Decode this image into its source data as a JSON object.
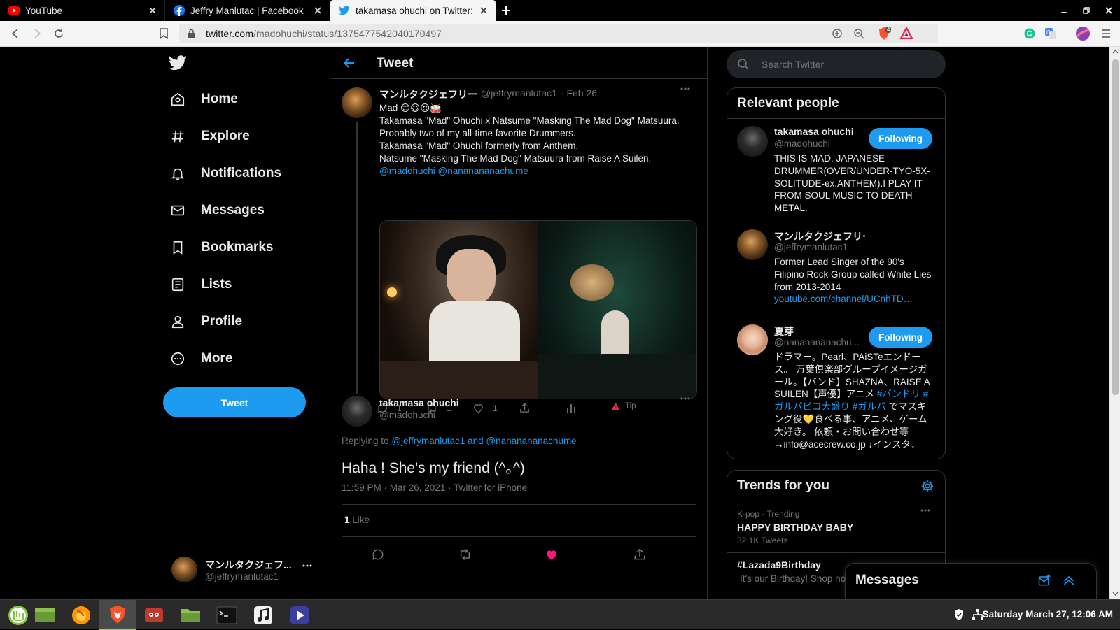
{
  "browser": {
    "tabs": [
      {
        "title": "YouTube",
        "icon": "youtube-icon"
      },
      {
        "title": "Jeffry Manlutac | Facebook",
        "icon": "facebook-icon"
      },
      {
        "title": "takamasa ohuchi on Twitter: \"@",
        "icon": "twitter-icon"
      }
    ],
    "url_host": "twitter.com",
    "url_path": "/madohuchi/status/1375477542040170497",
    "extension_badge": "4"
  },
  "sidebar": {
    "items": [
      {
        "label": "Home",
        "icon": "home-icon"
      },
      {
        "label": "Explore",
        "icon": "hashtag-icon"
      },
      {
        "label": "Notifications",
        "icon": "bell-icon"
      },
      {
        "label": "Messages",
        "icon": "envelope-icon"
      },
      {
        "label": "Bookmarks",
        "icon": "bookmark-icon"
      },
      {
        "label": "Lists",
        "icon": "list-icon"
      },
      {
        "label": "Profile",
        "icon": "person-icon"
      },
      {
        "label": "More",
        "icon": "more-circle-icon"
      }
    ],
    "tweet_button": "Tweet",
    "account": {
      "name": "マンルタクジェフ...",
      "handle": "@jeffrymanlutac1"
    }
  },
  "main": {
    "header_title": "Tweet",
    "parent_tweet": {
      "name": "マンルタクジェフリー",
      "handle": "@jeffrymanlutac1",
      "date": "· Feb 26",
      "line1": "Mad 😊😃😍🥁",
      "line2": "Takamasa \"Mad\" Ohuchi x Natsume \"Masking The Mad Dog\" Matsuura.",
      "line3": "Probably two of my all-time favorite Drummers.",
      "line4": "Takamasa \"Mad\" Ohuchi formerly from Anthem.",
      "line5": "Natsume \"Masking The Mad Dog\" Matsuura from Raise A Suilen.",
      "mention1": "@madohuchi",
      "mention2": "@nananananachume",
      "replies": "1",
      "retweets": "1",
      "likes": "1",
      "tip_label": "Tip"
    },
    "focused_tweet": {
      "name": "takamasa ohuchi",
      "handle": "@madohuchi",
      "replying_prefix": "Replying to",
      "replying_to1": "@jeffrymanlutac1",
      "replying_and": "and",
      "replying_to2": "@nananananachume",
      "text": "Haha ! She's my friend (^｡^)",
      "meta": "11:59 PM · Mar 26, 2021 · Twitter for iPhone",
      "like_count": "1",
      "like_label": "Like"
    }
  },
  "right": {
    "search_placeholder": "Search Twitter",
    "relevant_title": "Relevant people",
    "people": [
      {
        "name": "takamasa ohuchi",
        "handle": "@madohuchi",
        "button": "Following",
        "bio": "THIS IS MAD. JAPANESE DRUMMER(OVER/UNDER-TYO-5X-SOLITUDE-ex.ANTHEM).I PLAY IT FROM SOUL MUSIC TO DEATH METAL."
      },
      {
        "name": "マンルタクジェフリー",
        "handle": "@jeffrymanlutac1",
        "bio": "Former Lead Singer of the 90's Filipino Rock Group called White Lies from 2013-2014",
        "link": "youtube.com/channel/UCnhTD…"
      },
      {
        "name": "夏芽",
        "handle": "@nananananachu...",
        "button": "Following",
        "bio_a": "ドラマー。Pearl、PAiSTeエンドース。 万葉倶楽部グループイメージガール。【バンド】SHAZNA、RAISE A SUILEN【声優】アニメ ",
        "bio_tags": "#バンドリ #ガルパピコ大盛り #ガルパ",
        "bio_b": " でマスキング役💛食べる事、アニメ、ゲーム大好き。 依頼・お問い合わせ等→info@acecrew.co.jp ↓インスタ↓"
      }
    ],
    "trends_title": "Trends for you",
    "trends": [
      {
        "category": "K-pop · Trending",
        "title": "HAPPY BIRTHDAY BABY",
        "count": "32.1K Tweets"
      },
      {
        "title": "#Lazada9Birthday",
        "desc": "It's our Birthday! Shop no"
      }
    ],
    "messages_title": "Messages"
  },
  "taskbar": {
    "clock": "Saturday March 27, 12:06 AM"
  },
  "colors": {
    "accent": "#1d9bf0",
    "like": "#f91880",
    "bg": "#000000"
  }
}
